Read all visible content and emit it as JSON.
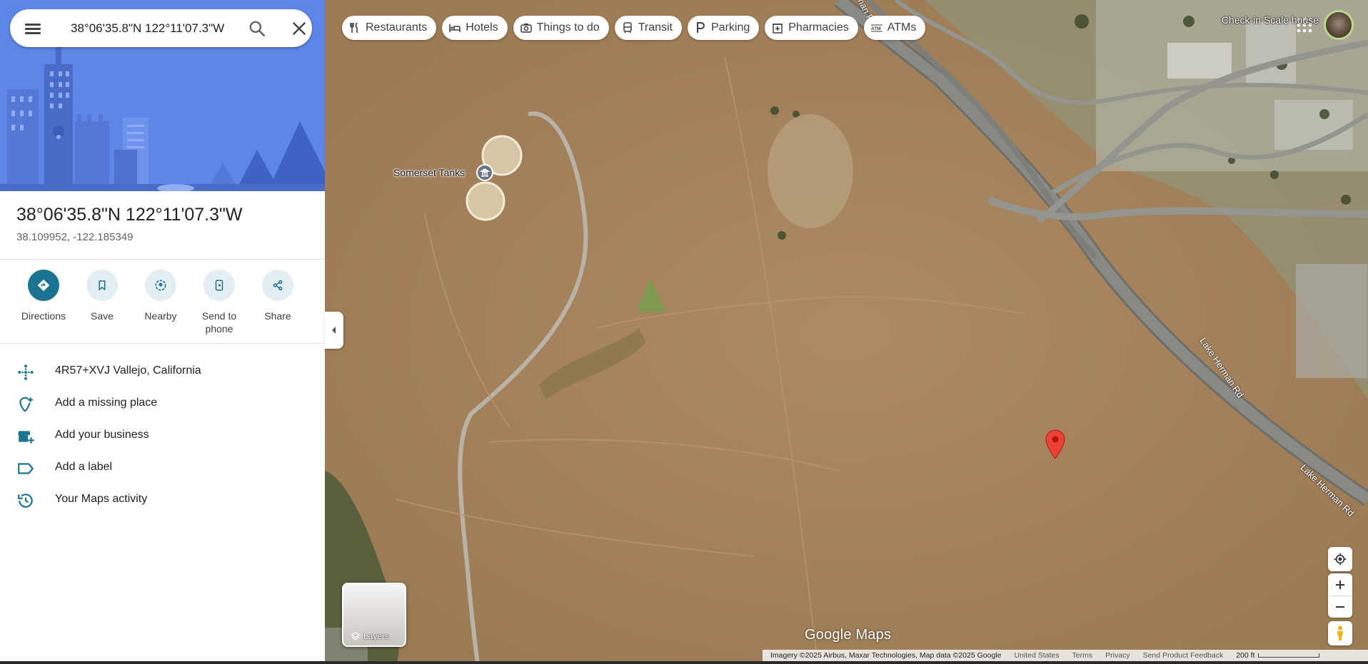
{
  "search": {
    "query": "38°06'35.8\"N 122°11'07.3\"W",
    "menu_icon": "menu-icon",
    "search_icon": "search-icon",
    "clear_icon": "close-icon"
  },
  "place": {
    "title": "38°06'35.8\"N 122°11'07.3\"W",
    "decimal": "38.109952, -122.185349"
  },
  "actions": [
    {
      "label": "Directions",
      "icon": "directions-icon"
    },
    {
      "label": "Save",
      "icon": "bookmark-icon"
    },
    {
      "label": "Nearby",
      "icon": "nearby-icon"
    },
    {
      "label": "Send to phone",
      "icon": "send-to-phone-icon"
    },
    {
      "label": "Share",
      "icon": "share-icon"
    }
  ],
  "info_rows": [
    {
      "text": "4R57+XVJ Vallejo, California",
      "icon": "plus-code-icon"
    },
    {
      "text": "Add a missing place",
      "icon": "add-location-icon"
    },
    {
      "text": "Add your business",
      "icon": "add-business-icon"
    },
    {
      "text": "Add a label",
      "icon": "label-icon"
    },
    {
      "text": "Your Maps activity",
      "icon": "history-icon"
    }
  ],
  "chips": [
    {
      "label": "Restaurants",
      "icon": "restaurant-icon"
    },
    {
      "label": "Hotels",
      "icon": "hotel-icon"
    },
    {
      "label": "Things to do",
      "icon": "camera-icon"
    },
    {
      "label": "Transit",
      "icon": "transit-icon"
    },
    {
      "label": "Parking",
      "icon": "parking-icon"
    },
    {
      "label": "Pharmacies",
      "icon": "pharmacy-icon"
    },
    {
      "label": "ATMs",
      "icon": "atm-icon"
    }
  ],
  "top_right": {
    "overlap_text": "Check-in Scale house",
    "apps_icon": "apps-grid-icon",
    "avatar": "account-avatar"
  },
  "map": {
    "poi_label": "Somerset Tanks",
    "roads": [
      "Lake Herman Rd",
      "Lake Herman Rd",
      "man Rd"
    ],
    "logo": "Google Maps",
    "layers_label": "Layers"
  },
  "footer": {
    "imagery": "Imagery ©2025 Airbus, Maxar Technologies, Map data ©2025 Google",
    "country": "United States",
    "terms": "Terms",
    "privacy": "Privacy",
    "feedback": "Send Product Feedback",
    "scale": "200 ft"
  },
  "colors": {
    "accent": "#1a7390",
    "hero_blue": "#5d86e8",
    "pin_red": "#ea4335",
    "terrain": "#a6835b"
  }
}
